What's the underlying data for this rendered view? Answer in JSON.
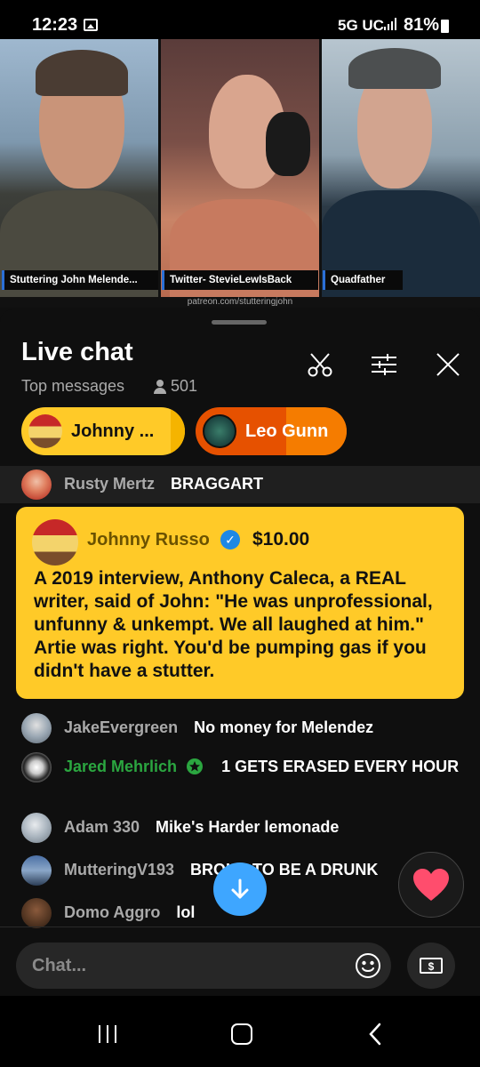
{
  "status_bar": {
    "time": "12:23",
    "network": "5G UC",
    "battery": "81%"
  },
  "video": {
    "label_1": "Stuttering John Melende...",
    "label_2": "Twitter- StevieLewIsBack",
    "label_3": "Quadfather",
    "watermark": "patreon.com/stutteringjohn"
  },
  "chat": {
    "title": "Live chat",
    "mode": "Top messages",
    "viewers": "501"
  },
  "tickers": [
    {
      "name": "Johnny ...",
      "color": "#ffca28"
    },
    {
      "name": "Leo Gunn",
      "color": "#e65100"
    }
  ],
  "pinned": {
    "name": "Rusty Mertz",
    "message": "BRAGGART"
  },
  "superchat": {
    "name": "Johnny Russo",
    "amount": "$10.00",
    "message": "A 2019 interview, Anthony Caleca, a REAL writer, said of John: \"He was unprofessional, unfunny & unkempt. We all laughed at him.\" Artie was right. You'd be pumping gas if you didn't have a stutter.",
    "color": "#ffca28"
  },
  "messages": [
    {
      "name": "JakeEvergreen",
      "message": "No money for Melendez"
    },
    {
      "name": "Jared Mehrlich",
      "message": "1 GETS ERASED EVERY HOUR",
      "member": true,
      "name_color": "#2ba640"
    },
    {
      "name": "Adam 330",
      "message": "Mike's Harder lemonade"
    },
    {
      "name": "MutteringV193",
      "message": "BROKE TO BE A DRUNK"
    },
    {
      "name": "Domo Aggro",
      "message": "lol"
    }
  ],
  "input": {
    "placeholder": "Chat..."
  },
  "icons": {
    "clip": "scissors-icon",
    "filter": "sliders-icon",
    "close": "close-icon",
    "jump": "arrow-down-icon",
    "react": "heart-icon",
    "emoji": "smiley-icon",
    "super": "dollar-bill-icon"
  }
}
